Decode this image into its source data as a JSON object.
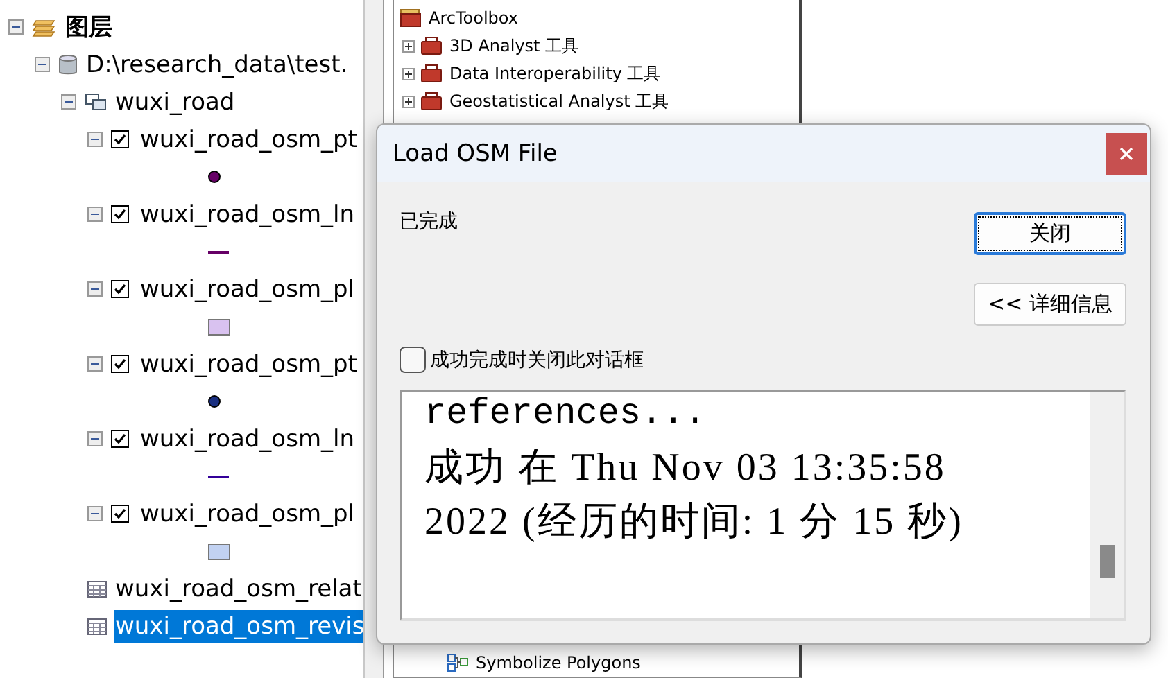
{
  "toc": {
    "items": [
      {
        "kind": "root",
        "label": "图层",
        "expanded": true,
        "children": [
          {
            "kind": "database",
            "label": "D:\\research_data\\test.",
            "expanded": true,
            "children": [
              {
                "kind": "group",
                "label": "wuxi_road",
                "expanded": true,
                "children": [
                  {
                    "kind": "layer",
                    "label": "wuxi_road_osm_pt",
                    "expanded": true,
                    "checked": true,
                    "selected": false,
                    "symbol": {
                      "kind": "point",
                      "color": "#660066"
                    }
                  },
                  {
                    "kind": "layer",
                    "label": "wuxi_road_osm_ln",
                    "expanded": true,
                    "checked": true,
                    "selected": false,
                    "symbol": {
                      "kind": "line",
                      "color": "#660066"
                    }
                  },
                  {
                    "kind": "layer",
                    "label": "wuxi_road_osm_pl",
                    "expanded": true,
                    "checked": true,
                    "selected": false,
                    "symbol": {
                      "kind": "polygon",
                      "color": "#d9c2f0"
                    }
                  },
                  {
                    "kind": "layer",
                    "label": "wuxi_road_osm_pt",
                    "expanded": true,
                    "checked": true,
                    "selected": false,
                    "symbol": {
                      "kind": "point",
                      "color": "#1a2f80"
                    }
                  },
                  {
                    "kind": "layer",
                    "label": "wuxi_road_osm_ln",
                    "expanded": true,
                    "checked": true,
                    "selected": false,
                    "symbol": {
                      "kind": "line",
                      "color": "#330099"
                    }
                  },
                  {
                    "kind": "layer",
                    "label": "wuxi_road_osm_pl",
                    "expanded": true,
                    "checked": true,
                    "selected": false,
                    "symbol": {
                      "kind": "polygon",
                      "color": "#c2d2f2"
                    }
                  },
                  {
                    "kind": "table",
                    "label": "wuxi_road_osm_relat",
                    "selected": false
                  },
                  {
                    "kind": "table",
                    "label": "wuxi_road_osm_revis",
                    "selected": true
                  }
                ]
              }
            ]
          }
        ]
      }
    ]
  },
  "toolbox": {
    "title": "ArcToolbox",
    "items": [
      {
        "label": "3D Analyst 工具",
        "expanded": false
      },
      {
        "label": "Data Interoperability 工具",
        "expanded": false
      },
      {
        "label": "Geostatistical Analyst 工具",
        "expanded": false
      }
    ],
    "tools": [
      "Symbolize Polygons"
    ]
  },
  "dialog": {
    "title": "Load OSM File",
    "status": "已完成",
    "close_button": "关闭",
    "details_button": "<< 详细信息",
    "close_on_success": {
      "label": "成功完成时关闭此对话框",
      "checked": false
    },
    "log": [
      {
        "kind": "mono",
        "text": "references..."
      },
      {
        "kind": "message",
        "text": "成功 在 Thu Nov 03 13:35:58 2022 (经历的时间: 1 分 15 秒)"
      }
    ]
  }
}
